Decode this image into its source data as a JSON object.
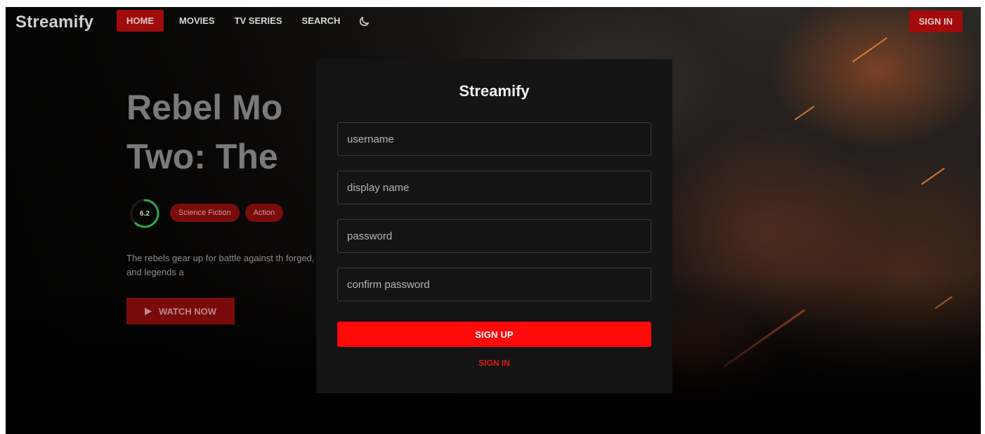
{
  "header": {
    "logo": "Streamify",
    "nav": [
      "HOME",
      "MOVIES",
      "TV SERIES",
      "SEARCH"
    ],
    "theme_icon": "moon-icon",
    "sign_in": "SIGN IN"
  },
  "hero": {
    "title": "Rebel Mo\nTwo: The",
    "rating": "6.2",
    "rating_fraction": 0.62,
    "genres": [
      "Science Fiction",
      "Action"
    ],
    "overview": "The rebels gear up for battle against th forged, heroes emerge — and legends a",
    "watch_label": "WATCH NOW",
    "watch_icon": "play-icon"
  },
  "modal": {
    "title": "Streamify",
    "username_placeholder": "username",
    "display_name_placeholder": "display name",
    "password_placeholder": "password",
    "confirm_password_placeholder": "confirm password",
    "sign_up": "SIGN UP",
    "sign_in": "SIGN IN"
  },
  "colors": {
    "brand_red": "#ff0a0a",
    "dark_red": "#a00c0c",
    "rating_green": "#2ea84a"
  }
}
